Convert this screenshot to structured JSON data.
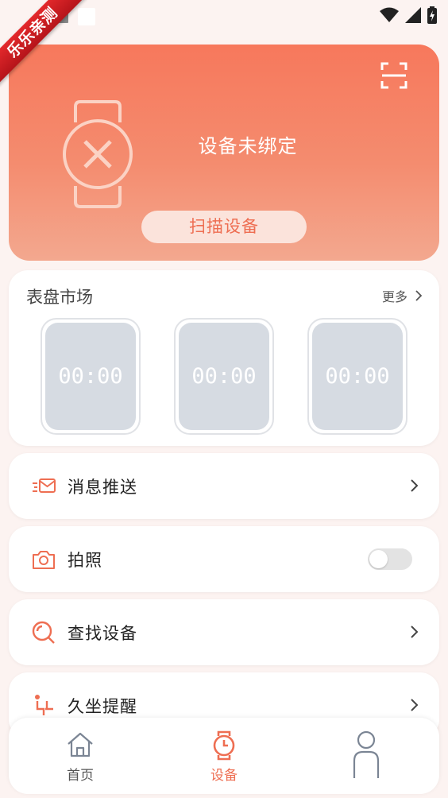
{
  "ribbon": {
    "text": "乐乐亲测"
  },
  "device": {
    "status_text": "设备未绑定",
    "scan_button_label": "扫描设备"
  },
  "watch_market": {
    "title": "表盘市场",
    "more_label": "更多",
    "faces": [
      {
        "time": "00:00"
      },
      {
        "time": "00:00"
      },
      {
        "time": "00:00"
      }
    ]
  },
  "features": {
    "message_push": {
      "label": "消息推送"
    },
    "camera": {
      "label": "拍照",
      "toggle_on": false
    },
    "find_device": {
      "label": "查找设备"
    },
    "sedentary_reminder": {
      "label": "久坐提醒"
    }
  },
  "tabbar": {
    "items": [
      {
        "label": "首页",
        "icon": "home-icon",
        "active": false
      },
      {
        "label": "设备",
        "icon": "watch-icon",
        "active": true
      },
      {
        "label": "",
        "icon": "profile-icon",
        "active": false
      }
    ]
  },
  "colors": {
    "accent": "#ee6e52",
    "hero_top": "#f7785c",
    "hero_bottom": "#f3a88f",
    "background": "#fcf3f1"
  }
}
